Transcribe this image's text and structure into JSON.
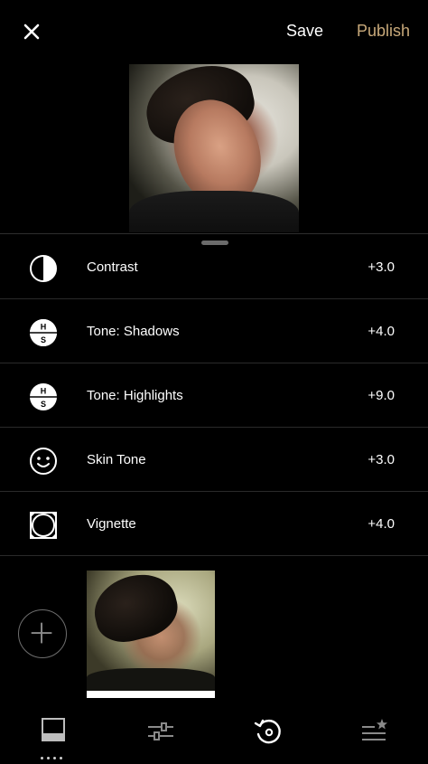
{
  "header": {
    "save_label": "Save",
    "publish_label": "Publish",
    "publish_color": "#c8a97a",
    "close_icon": "close-icon"
  },
  "tools": [
    {
      "label": "Contrast",
      "value": "+3.0",
      "icon": "contrast-icon"
    },
    {
      "label": "Tone: Shadows",
      "value": "+4.0",
      "icon": "tone-shadows-icon"
    },
    {
      "label": "Tone: Highlights",
      "value": "+9.0",
      "icon": "tone-highlights-icon"
    },
    {
      "label": "Skin Tone",
      "value": "+3.0",
      "icon": "skin-tone-icon"
    },
    {
      "label": "Vignette",
      "value": "+4.0",
      "icon": "vignette-icon"
    }
  ],
  "bottom_nav": [
    {
      "icon": "presets-icon",
      "active": false
    },
    {
      "icon": "adjust-sliders-icon",
      "active": false
    },
    {
      "icon": "history-icon",
      "active": true
    },
    {
      "icon": "recipes-icon",
      "active": false
    }
  ]
}
